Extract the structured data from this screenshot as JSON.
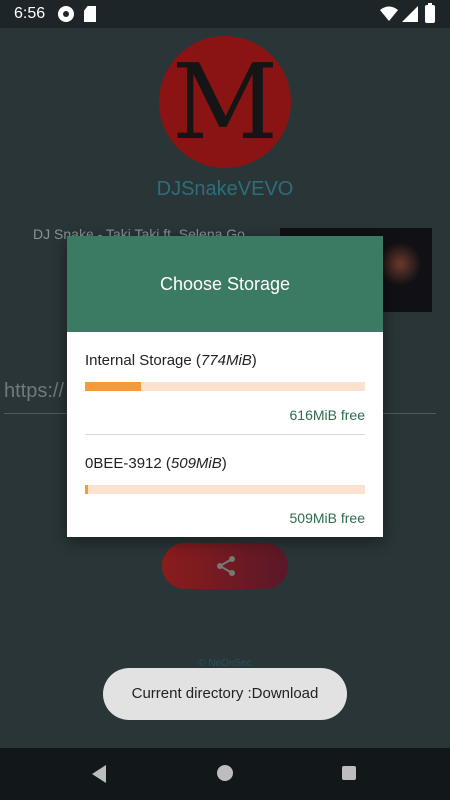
{
  "status_bar": {
    "time": "6:56"
  },
  "background": {
    "logo_letter": "M",
    "channel_name": "DJSnakeVEVO",
    "video_title": "DJ Snake - Taki Taki ft. Selena Go",
    "url_input_value": "https://",
    "credit": "© NeOnSec"
  },
  "dialog": {
    "title": "Choose Storage",
    "storages": [
      {
        "name": "Internal Storage",
        "size": "774MiB",
        "free": "616MiB free",
        "used_fraction": 0.2
      },
      {
        "name": "0BEE-3912",
        "size": "509MiB",
        "free": "509MiB free",
        "used_fraction": 0.01
      }
    ]
  },
  "toast": {
    "text": "Current directory :Download"
  },
  "colors": {
    "header": "#3b7a63",
    "accent": "#f49a3a",
    "free_text": "#2f6b4e"
  }
}
